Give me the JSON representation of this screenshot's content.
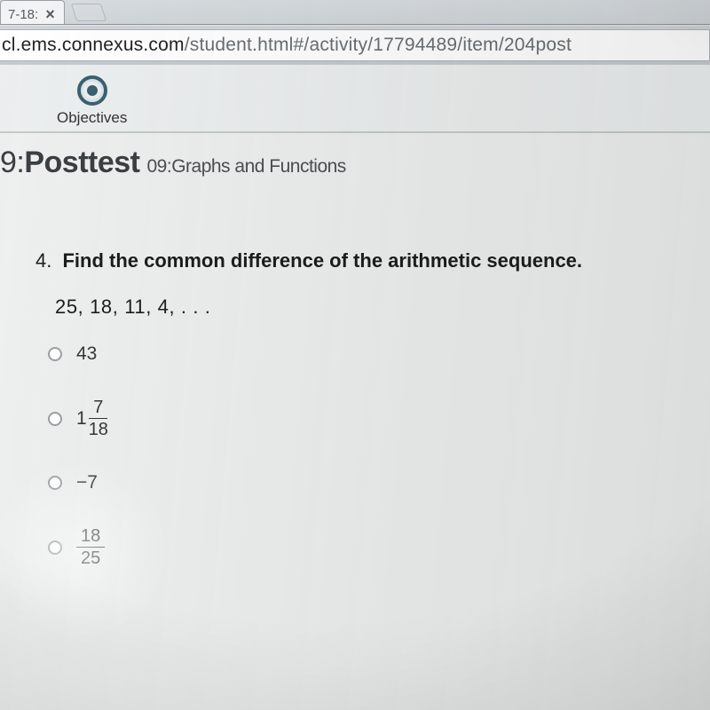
{
  "browser": {
    "tab_title_fragment": "7-18:",
    "url_partial": "cl.ems.connexus.com/student.html#/activity/17794489/item/204post",
    "url_domain": "cl.ems.connexus.com",
    "url_path": "/student.html#/activity/17794489/item/204post"
  },
  "toolbar": {
    "objectives_label": "Objectives"
  },
  "header": {
    "title_prefix": "9:",
    "title_main": "Posttest",
    "subtitle": "09:Graphs and Functions"
  },
  "question": {
    "number": "4.",
    "prompt": "Find the common difference of the arithmetic sequence.",
    "sequence": "25, 18, 11, 4, . . .",
    "options": [
      {
        "kind": "plain",
        "text": "43"
      },
      {
        "kind": "mixed",
        "whole": "1",
        "num": "7",
        "den": "18"
      },
      {
        "kind": "plain",
        "text": "−7"
      },
      {
        "kind": "fraction",
        "num": "18",
        "den": "25"
      }
    ]
  }
}
